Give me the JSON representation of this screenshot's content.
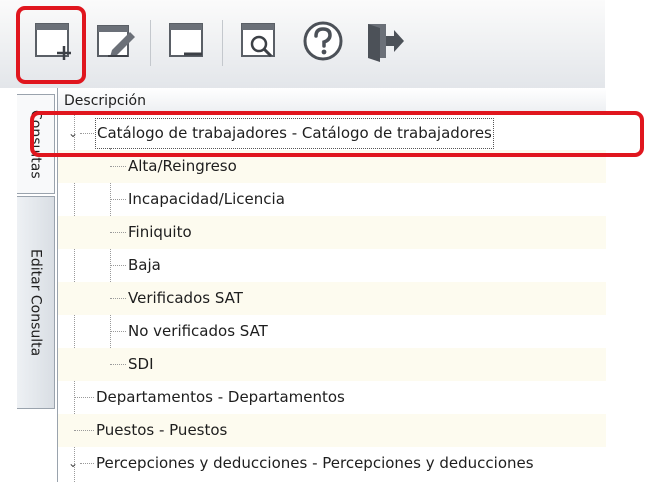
{
  "toolbar": {
    "buttons": [
      {
        "name": "new-query",
        "icon": "new-window-icon"
      },
      {
        "name": "edit-query",
        "icon": "edit-pencil-icon"
      },
      {
        "name": "delete-query",
        "icon": "remove-window-icon"
      },
      {
        "name": "preview-query",
        "icon": "search-window-icon"
      },
      {
        "name": "help",
        "icon": "question-icon"
      },
      {
        "name": "exit",
        "icon": "exit-door-icon"
      }
    ]
  },
  "sidetabs": {
    "consultas": "Consultas",
    "editar": "Editar Consulta"
  },
  "tree": {
    "column_header": "Descripción",
    "nodes": [
      {
        "label": "Catálogo de trabajadores - Catálogo de trabajadores",
        "expanded": true,
        "children": [
          "Alta/Reingreso",
          "Incapacidad/Licencia",
          "Finiquito",
          "Baja",
          "Verificados SAT",
          "No verificados SAT",
          "SDI"
        ]
      },
      {
        "label": "Departamentos - Departamentos"
      },
      {
        "label": "Puestos - Puestos"
      },
      {
        "label": "Percepciones y deducciones - Percepciones y deducciones",
        "expanded": true
      }
    ]
  },
  "colors": {
    "highlight": "#e0161e",
    "row_alt": "#fdfbef"
  }
}
